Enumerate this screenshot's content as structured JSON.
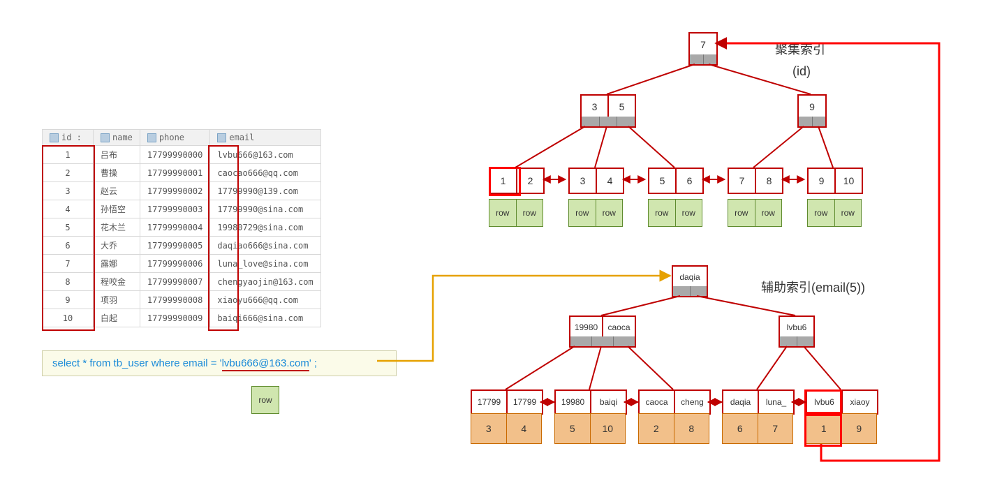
{
  "table": {
    "headers": {
      "id": "id :",
      "name": "name",
      "phone": "phone",
      "email": "email"
    },
    "rows": [
      {
        "id": "1",
        "name": "吕布",
        "phone": "17799990000",
        "email": "lvbu666@163.com"
      },
      {
        "id": "2",
        "name": "曹操",
        "phone": "17799990001",
        "email": "caocao666@qq.com"
      },
      {
        "id": "3",
        "name": "赵云",
        "phone": "17799990002",
        "email": "17799990@139.com"
      },
      {
        "id": "4",
        "name": "孙悟空",
        "phone": "17799990003",
        "email": "17799990@sina.com"
      },
      {
        "id": "5",
        "name": "花木兰",
        "phone": "17799990004",
        "email": "19980729@sina.com"
      },
      {
        "id": "6",
        "name": "大乔",
        "phone": "17799990005",
        "email": "daqiao666@sina.com"
      },
      {
        "id": "7",
        "name": "露娜",
        "phone": "17799990006",
        "email": "luna_love@sina.com"
      },
      {
        "id": "8",
        "name": "程咬金",
        "phone": "17799990007",
        "email": "chengyaojin@163.com"
      },
      {
        "id": "9",
        "name": "项羽",
        "phone": "17799990008",
        "email": "xiaoyu666@qq.com"
      },
      {
        "id": "10",
        "name": "白起",
        "phone": "17799990009",
        "email": "baiqi666@sina.com"
      }
    ]
  },
  "sql": {
    "prefix": "select * from tb_user where email = '",
    "highlight": "lvbu666@163.com",
    "suffix": "' ;"
  },
  "legend_row": "row",
  "labels": {
    "clustered_title": "聚集索引",
    "clustered_sub": "(id)",
    "secondary_title": "辅助索引(email(5))"
  },
  "clustered": {
    "root": [
      "7"
    ],
    "mid": [
      [
        "3",
        "5"
      ],
      [
        "9"
      ]
    ],
    "leaves": [
      [
        "1",
        "2"
      ],
      [
        "3",
        "4"
      ],
      [
        "5",
        "6"
      ],
      [
        "7",
        "8"
      ],
      [
        "9",
        "10"
      ]
    ],
    "row_label": "row"
  },
  "secondary": {
    "root": [
      "daqia"
    ],
    "mid": [
      [
        "19980",
        "caoca"
      ],
      [
        "lvbu6"
      ]
    ],
    "leaves": [
      {
        "keys": [
          "17799",
          "17799"
        ],
        "ids": [
          "3",
          "4"
        ]
      },
      {
        "keys": [
          "19980",
          "baiqi"
        ],
        "ids": [
          "5",
          "10"
        ]
      },
      {
        "keys": [
          "caoca",
          "cheng"
        ],
        "ids": [
          "2",
          "8"
        ]
      },
      {
        "keys": [
          "daqia",
          "luna_"
        ],
        "ids": [
          "6",
          "7"
        ]
      },
      {
        "keys": [
          "lvbu6",
          "xiaoy"
        ],
        "ids": [
          "1",
          "9"
        ]
      }
    ]
  }
}
